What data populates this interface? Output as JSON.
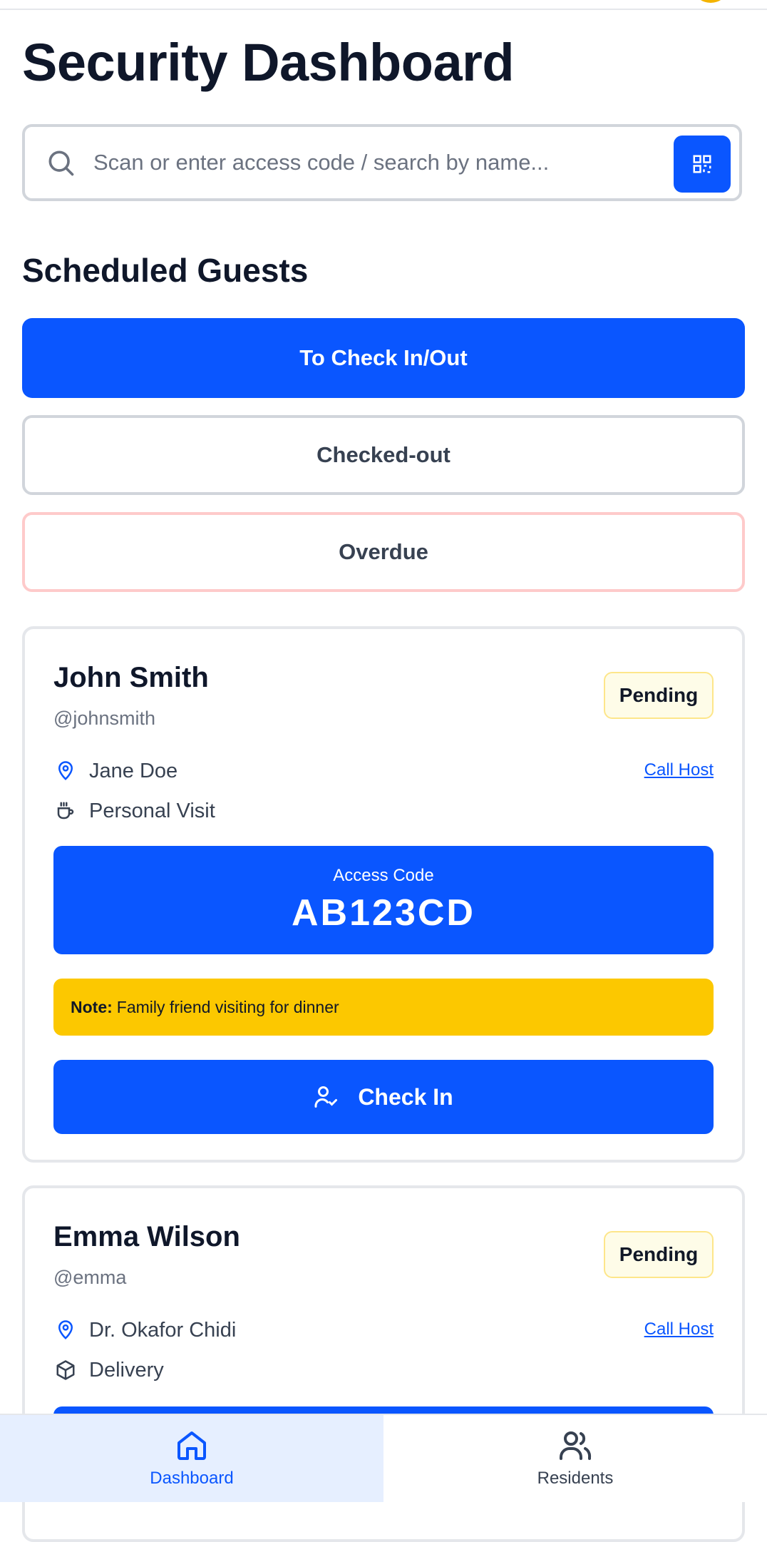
{
  "page": {
    "title": "Security Dashboard"
  },
  "search": {
    "placeholder": "Scan or enter access code / search by name..."
  },
  "section": {
    "title": "Scheduled Guests"
  },
  "filters": {
    "active": "To Check In/Out",
    "checked_out": "Checked-out",
    "overdue": "Overdue"
  },
  "guests": [
    {
      "name": "John Smith",
      "handle": "@johnsmith",
      "status": "Pending",
      "host": "Jane Doe",
      "purpose": "Personal Visit",
      "call_label": "Call Host",
      "access_label": "Access Code",
      "access_code": "AB123CD",
      "note_label": "Note:",
      "note": "Family friend visiting for dinner",
      "action": "Check In"
    },
    {
      "name": "Emma Wilson",
      "handle": "@emma",
      "status": "Pending",
      "host": "Dr. Okafor Chidi",
      "purpose": "Delivery",
      "call_label": "Call Host"
    }
  ],
  "nav": {
    "dashboard": "Dashboard",
    "residents": "Residents"
  },
  "colors": {
    "accent": "#0a56ff",
    "note": "#fcc800",
    "pending_bg": "#fefce8",
    "overdue_border": "#fecaca"
  },
  "icons": [
    "search-icon",
    "qr-code-icon",
    "map-pin-icon",
    "coffee-icon",
    "package-icon",
    "user-check-icon",
    "home-icon",
    "users-icon"
  ]
}
